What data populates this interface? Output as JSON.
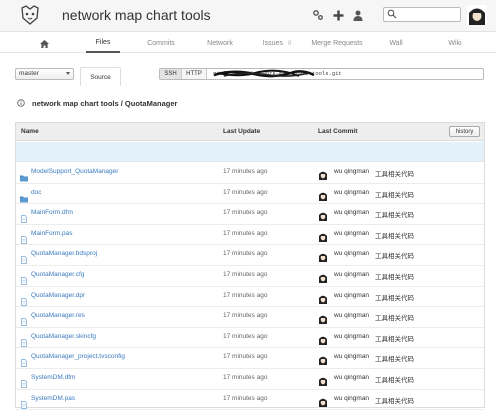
{
  "header": {
    "title": "network map chart tools",
    "icons": [
      "settings-icon",
      "plus-icon",
      "user-icon",
      "search-icon"
    ],
    "search_placeholder": ""
  },
  "nav": {
    "tabs": [
      {
        "key": "home",
        "label": "",
        "icon": "home-icon"
      },
      {
        "key": "files",
        "label": "Files",
        "active": true
      },
      {
        "key": "commits",
        "label": "Commits"
      },
      {
        "key": "network",
        "label": "Network"
      },
      {
        "key": "issues",
        "label": "Issues",
        "badge": "0"
      },
      {
        "key": "merge_requests",
        "label": "Merge Requests"
      },
      {
        "key": "wall",
        "label": "Wall"
      },
      {
        "key": "wiki",
        "label": "Wiki"
      }
    ]
  },
  "repo": {
    "branch": "master",
    "source_tab": "Source",
    "clone": {
      "ssh_label": "SSH",
      "http_label": "HTTP",
      "url": "git@...:.../network-map-chart-tools.git"
    },
    "breadcrumb": "network map chart tools / QuotaManager"
  },
  "table": {
    "columns": {
      "name": "Name",
      "last_update": "Last Update",
      "last_commit": "Last Commit"
    },
    "history_label": "history",
    "rows": [
      {
        "type": "folder",
        "name": "ModelSupport_QuotaManager",
        "updated": "17 minutes ago",
        "author": "wu qingman",
        "message": "工具相关代码"
      },
      {
        "type": "folder",
        "name": "doc",
        "updated": "17 minutes ago",
        "author": "wu qingman",
        "message": "工具相关代码"
      },
      {
        "type": "file",
        "name": "MainForm.dfm",
        "updated": "17 minutes ago",
        "author": "wu qingman",
        "message": "工具相关代码"
      },
      {
        "type": "file",
        "name": "MainForm.pas",
        "updated": "17 minutes ago",
        "author": "wu qingman",
        "message": "工具相关代码"
      },
      {
        "type": "file",
        "name": "QuotaManager.bdsproj",
        "updated": "17 minutes ago",
        "author": "wu qingman",
        "message": "工具相关代码"
      },
      {
        "type": "file",
        "name": "QuotaManager.cfg",
        "updated": "17 minutes ago",
        "author": "wu qingman",
        "message": "工具相关代码"
      },
      {
        "type": "file",
        "name": "QuotaManager.dpr",
        "updated": "17 minutes ago",
        "author": "wu qingman",
        "message": "工具相关代码"
      },
      {
        "type": "file",
        "name": "QuotaManager.res",
        "updated": "17 minutes ago",
        "author": "wu qingman",
        "message": "工具相关代码"
      },
      {
        "type": "file",
        "name": "QuotaManager.skincfg",
        "updated": "17 minutes ago",
        "author": "wu qingman",
        "message": "工具相关代码"
      },
      {
        "type": "file",
        "name": "QuotaManager_project.tvsconfig",
        "updated": "17 minutes ago",
        "author": "wu qingman",
        "message": "工具相关代码"
      },
      {
        "type": "file",
        "name": "SystemDM.dfm",
        "updated": "17 minutes ago",
        "author": "wu qingman",
        "message": "工具相关代码"
      },
      {
        "type": "file",
        "name": "SystemDM.pas",
        "updated": "17 minutes ago",
        "author": "wu qingman",
        "message": "工具相关代码"
      }
    ]
  },
  "colors": {
    "link": "#3a7bbf",
    "folder": "#4a8bc4",
    "updir_row": "#e3f1fb"
  }
}
